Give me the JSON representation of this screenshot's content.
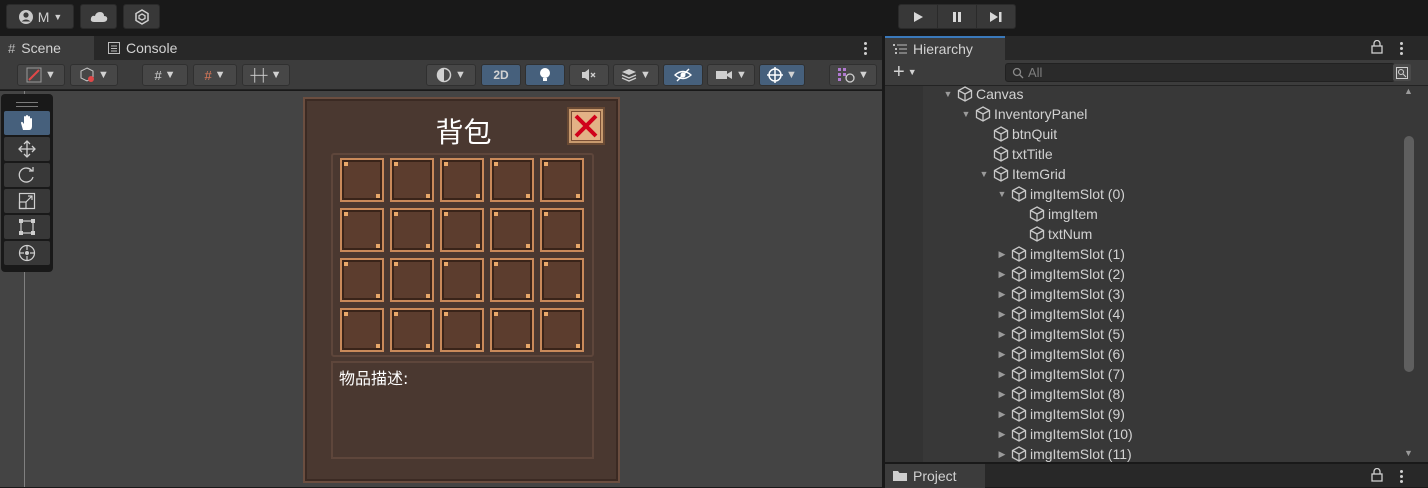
{
  "topbar": {
    "account_label": "M",
    "play_icons": [
      "play-icon",
      "pause-icon",
      "step-icon"
    ]
  },
  "scene": {
    "tabs": [
      {
        "label": "Scene",
        "icon": "grid-icon"
      },
      {
        "label": "Console",
        "icon": "console-icon"
      }
    ],
    "toolbar": {
      "btn_2d": "2D"
    },
    "tools": [
      "hand-tool",
      "move-tool",
      "rotate-tool",
      "scale-tool",
      "rect-tool",
      "transform-tool"
    ]
  },
  "game_ui": {
    "title": "背包",
    "slot_rows": 4,
    "slot_cols": 5,
    "description_label": "物品描述:",
    "colors": {
      "panel": "#4a3830",
      "slot": "#5c3d2e",
      "slot_border": "#c98a5a",
      "close": "#e3b286",
      "close_x": "#d0021b"
    }
  },
  "hierarchy": {
    "tab_label": "Hierarchy",
    "search_placeholder": "All",
    "items": [
      {
        "label": "Canvas",
        "depth": 0,
        "arrow": "down"
      },
      {
        "label": "InventoryPanel",
        "depth": 1,
        "arrow": "down"
      },
      {
        "label": "btnQuit",
        "depth": 2,
        "arrow": "none"
      },
      {
        "label": "txtTitle",
        "depth": 2,
        "arrow": "none"
      },
      {
        "label": "ItemGrid",
        "depth": 2,
        "arrow": "down"
      },
      {
        "label": "imgItemSlot (0)",
        "depth": 3,
        "arrow": "down"
      },
      {
        "label": "imgItem",
        "depth": 4,
        "arrow": "none"
      },
      {
        "label": "txtNum",
        "depth": 4,
        "arrow": "none"
      },
      {
        "label": "imgItemSlot (1)",
        "depth": 3,
        "arrow": "right"
      },
      {
        "label": "imgItemSlot (2)",
        "depth": 3,
        "arrow": "right"
      },
      {
        "label": "imgItemSlot (3)",
        "depth": 3,
        "arrow": "right"
      },
      {
        "label": "imgItemSlot (4)",
        "depth": 3,
        "arrow": "right"
      },
      {
        "label": "imgItemSlot (5)",
        "depth": 3,
        "arrow": "right"
      },
      {
        "label": "imgItemSlot (6)",
        "depth": 3,
        "arrow": "right"
      },
      {
        "label": "imgItemSlot (7)",
        "depth": 3,
        "arrow": "right"
      },
      {
        "label": "imgItemSlot (8)",
        "depth": 3,
        "arrow": "right"
      },
      {
        "label": "imgItemSlot (9)",
        "depth": 3,
        "arrow": "right"
      },
      {
        "label": "imgItemSlot (10)",
        "depth": 3,
        "arrow": "right"
      },
      {
        "label": "imgItemSlot (11)",
        "depth": 3,
        "arrow": "right"
      }
    ]
  },
  "project": {
    "tab_label": "Project"
  }
}
